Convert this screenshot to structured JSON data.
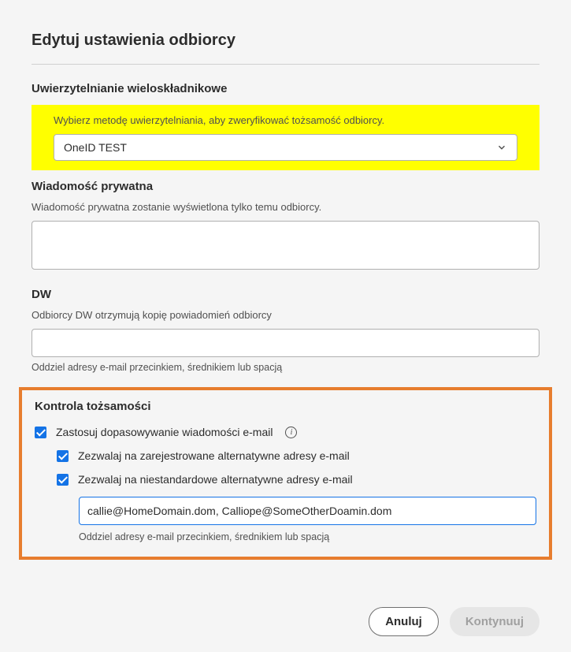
{
  "title": "Edytuj ustawienia odbiorcy",
  "mfa": {
    "heading": "Uwierzytelnianie wieloskładnikowe",
    "hint": "Wybierz metodę uwierzytelniania, aby zweryfikować tożsamość odbiorcy.",
    "selected": "OneID TEST"
  },
  "privateMsg": {
    "heading": "Wiadomość prywatna",
    "hint": "Wiadomość prywatna zostanie wyświetlona tylko temu odbiorcy.",
    "value": ""
  },
  "cc": {
    "heading": "DW",
    "hint": "Odbiorcy DW otrzymują kopię powiadomień odbiorcy",
    "value": "",
    "separatorHint": "Oddziel adresy e-mail przecinkiem, średnikiem lub spacją"
  },
  "identity": {
    "heading": "Kontrola tożsamości",
    "match": {
      "label": "Zastosuj dopasowywanie wiadomości e-mail",
      "checked": true
    },
    "allowRegistered": {
      "label": "Zezwalaj na zarejestrowane alternatywne adresy e-mail",
      "checked": true
    },
    "allowCustom": {
      "label": "Zezwalaj na niestandardowe alternatywne adresy e-mail",
      "checked": true,
      "value": "callie@HomeDomain.dom, Calliope@SomeOtherDoamin.dom",
      "hint": "Oddziel adresy e-mail przecinkiem, średnikiem lub spacją"
    }
  },
  "footer": {
    "cancel": "Anuluj",
    "continue": "Kontynuuj"
  }
}
